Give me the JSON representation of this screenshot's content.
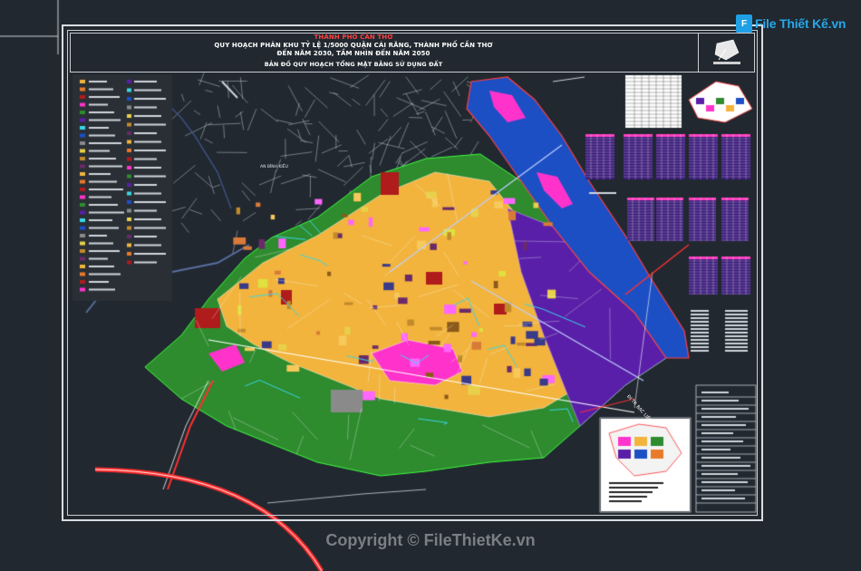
{
  "sheet": {
    "title_line1": "THÀNH PHỐ CẦN THƠ",
    "title_line2": "QUY HOẠCH PHÂN KHU TỶ LỆ 1/5000 QUẬN CÁI RĂNG, THÀNH PHỐ CẦN THƠ",
    "title_line3": "ĐẾN NĂM 2030, TẦM NHÌN ĐẾN NĂM 2050",
    "subtitle": "BẢN ĐỒ QUY HOẠCH TỔNG MẶT BẰNG SỬ DỤNG ĐẤT"
  },
  "labels": {
    "road_right": "ĐI TP. BẠC LIÊU",
    "ward_label": "AN BÌNH KIỀU"
  },
  "watermark": {
    "brand_icon_text": "F",
    "brand_text": "File Thiết Kế.vn",
    "copyright": "Copyright © FileThietKe.vn"
  },
  "colors": {
    "background": "#212830",
    "residential": "#f2b43c",
    "green": "#2e8b2e",
    "water": "#1d4fc4",
    "industrial": "#5a1fa8",
    "commercial": "#ff33cc",
    "public": "#b01b1b"
  }
}
